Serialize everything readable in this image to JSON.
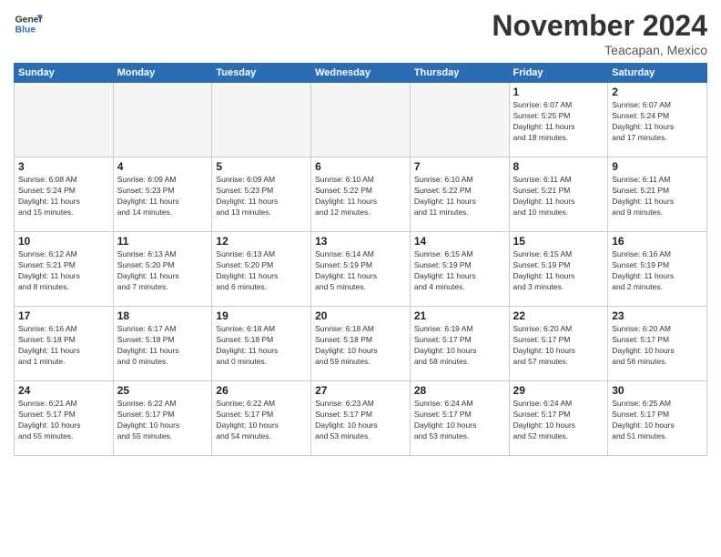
{
  "logo": {
    "general": "General",
    "blue": "Blue"
  },
  "header": {
    "month": "November 2024",
    "location": "Teacapan, Mexico"
  },
  "weekdays": [
    "Sunday",
    "Monday",
    "Tuesday",
    "Wednesday",
    "Thursday",
    "Friday",
    "Saturday"
  ],
  "weeks": [
    [
      {
        "day": "",
        "info": ""
      },
      {
        "day": "",
        "info": ""
      },
      {
        "day": "",
        "info": ""
      },
      {
        "day": "",
        "info": ""
      },
      {
        "day": "",
        "info": ""
      },
      {
        "day": "1",
        "info": "Sunrise: 6:07 AM\nSunset: 5:25 PM\nDaylight: 11 hours\nand 18 minutes."
      },
      {
        "day": "2",
        "info": "Sunrise: 6:07 AM\nSunset: 5:24 PM\nDaylight: 11 hours\nand 17 minutes."
      }
    ],
    [
      {
        "day": "3",
        "info": "Sunrise: 6:08 AM\nSunset: 5:24 PM\nDaylight: 11 hours\nand 15 minutes."
      },
      {
        "day": "4",
        "info": "Sunrise: 6:09 AM\nSunset: 5:23 PM\nDaylight: 11 hours\nand 14 minutes."
      },
      {
        "day": "5",
        "info": "Sunrise: 6:09 AM\nSunset: 5:23 PM\nDaylight: 11 hours\nand 13 minutes."
      },
      {
        "day": "6",
        "info": "Sunrise: 6:10 AM\nSunset: 5:22 PM\nDaylight: 11 hours\nand 12 minutes."
      },
      {
        "day": "7",
        "info": "Sunrise: 6:10 AM\nSunset: 5:22 PM\nDaylight: 11 hours\nand 11 minutes."
      },
      {
        "day": "8",
        "info": "Sunrise: 6:11 AM\nSunset: 5:21 PM\nDaylight: 11 hours\nand 10 minutes."
      },
      {
        "day": "9",
        "info": "Sunrise: 6:11 AM\nSunset: 5:21 PM\nDaylight: 11 hours\nand 9 minutes."
      }
    ],
    [
      {
        "day": "10",
        "info": "Sunrise: 6:12 AM\nSunset: 5:21 PM\nDaylight: 11 hours\nand 8 minutes."
      },
      {
        "day": "11",
        "info": "Sunrise: 6:13 AM\nSunset: 5:20 PM\nDaylight: 11 hours\nand 7 minutes."
      },
      {
        "day": "12",
        "info": "Sunrise: 6:13 AM\nSunset: 5:20 PM\nDaylight: 11 hours\nand 6 minutes."
      },
      {
        "day": "13",
        "info": "Sunrise: 6:14 AM\nSunset: 5:19 PM\nDaylight: 11 hours\nand 5 minutes."
      },
      {
        "day": "14",
        "info": "Sunrise: 6:15 AM\nSunset: 5:19 PM\nDaylight: 11 hours\nand 4 minutes."
      },
      {
        "day": "15",
        "info": "Sunrise: 6:15 AM\nSunset: 5:19 PM\nDaylight: 11 hours\nand 3 minutes."
      },
      {
        "day": "16",
        "info": "Sunrise: 6:16 AM\nSunset: 5:19 PM\nDaylight: 11 hours\nand 2 minutes."
      }
    ],
    [
      {
        "day": "17",
        "info": "Sunrise: 6:16 AM\nSunset: 5:18 PM\nDaylight: 11 hours\nand 1 minute."
      },
      {
        "day": "18",
        "info": "Sunrise: 6:17 AM\nSunset: 5:18 PM\nDaylight: 11 hours\nand 0 minutes."
      },
      {
        "day": "19",
        "info": "Sunrise: 6:18 AM\nSunset: 5:18 PM\nDaylight: 11 hours\nand 0 minutes."
      },
      {
        "day": "20",
        "info": "Sunrise: 6:18 AM\nSunset: 5:18 PM\nDaylight: 10 hours\nand 59 minutes."
      },
      {
        "day": "21",
        "info": "Sunrise: 6:19 AM\nSunset: 5:17 PM\nDaylight: 10 hours\nand 58 minutes."
      },
      {
        "day": "22",
        "info": "Sunrise: 6:20 AM\nSunset: 5:17 PM\nDaylight: 10 hours\nand 57 minutes."
      },
      {
        "day": "23",
        "info": "Sunrise: 6:20 AM\nSunset: 5:17 PM\nDaylight: 10 hours\nand 56 minutes."
      }
    ],
    [
      {
        "day": "24",
        "info": "Sunrise: 6:21 AM\nSunset: 5:17 PM\nDaylight: 10 hours\nand 55 minutes."
      },
      {
        "day": "25",
        "info": "Sunrise: 6:22 AM\nSunset: 5:17 PM\nDaylight: 10 hours\nand 55 minutes."
      },
      {
        "day": "26",
        "info": "Sunrise: 6:22 AM\nSunset: 5:17 PM\nDaylight: 10 hours\nand 54 minutes."
      },
      {
        "day": "27",
        "info": "Sunrise: 6:23 AM\nSunset: 5:17 PM\nDaylight: 10 hours\nand 53 minutes."
      },
      {
        "day": "28",
        "info": "Sunrise: 6:24 AM\nSunset: 5:17 PM\nDaylight: 10 hours\nand 53 minutes."
      },
      {
        "day": "29",
        "info": "Sunrise: 6:24 AM\nSunset: 5:17 PM\nDaylight: 10 hours\nand 52 minutes."
      },
      {
        "day": "30",
        "info": "Sunrise: 6:25 AM\nSunset: 5:17 PM\nDaylight: 10 hours\nand 51 minutes."
      }
    ]
  ]
}
